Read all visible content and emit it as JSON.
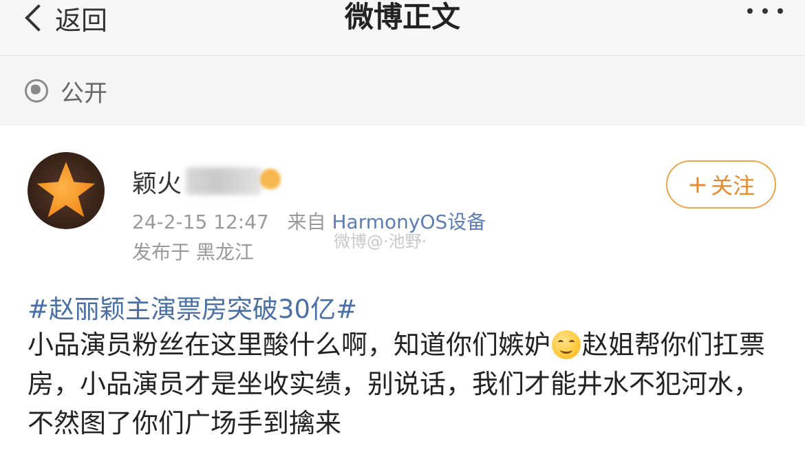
{
  "header": {
    "back_label": "返回",
    "title": "微博正文"
  },
  "visibility": {
    "label": "公开",
    "icon": "globe-icon"
  },
  "post": {
    "author_visible": "颖火",
    "meta_time": "24-2-15 12:47",
    "meta_source_prefix": "来自",
    "meta_source": "HarmonyOS设备",
    "location": "发布于 黑龙江",
    "watermark": "微博@·池野·",
    "follow_label": "关注",
    "hashtag": "#赵丽颖主演票房突破30亿#",
    "content_part1": "小品演员粉丝在这里酸什么啊，知道你们嫉妒",
    "emoji": "smile-emoji",
    "content_part2": "赵姐帮你们扛票房，小品演员才是坐收实绩，别说话，我们才能井水不犯河水，不然图了你们广场手到擒来"
  },
  "colors": {
    "link_blue": "#4a6fa5",
    "follow_orange": "#e8892b",
    "meta_gray": "#999999"
  }
}
